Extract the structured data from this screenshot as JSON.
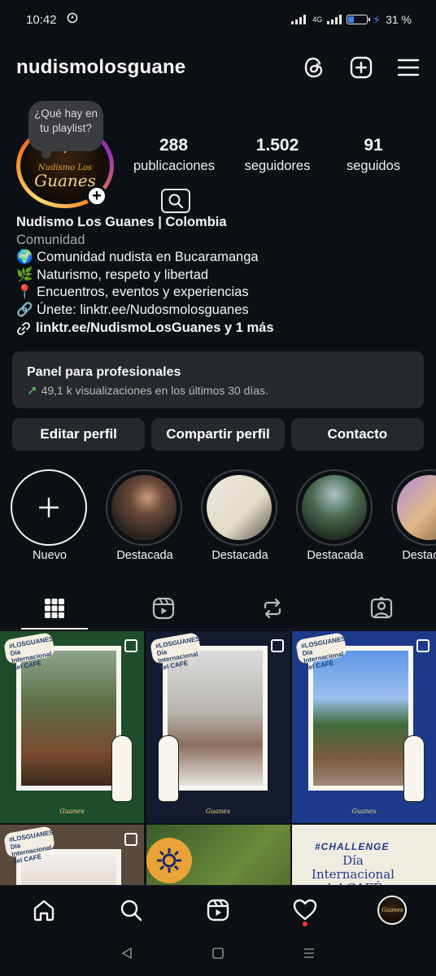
{
  "status_bar": {
    "time": "10:42",
    "battery_pct": "31 %",
    "network": "4G",
    "battery_level": 0.31
  },
  "header": {
    "username": "nudismolosguane",
    "icons": [
      "threads-icon",
      "add-post-icon",
      "menu-icon"
    ]
  },
  "note": {
    "text": "¿Qué hay en tu playlist?"
  },
  "avatar": {
    "logo_top": "Nudismo Los",
    "logo_main": "Guanes"
  },
  "stats": [
    {
      "value": "288",
      "label": "publicaciones"
    },
    {
      "value": "1.502",
      "label": "seguidores"
    },
    {
      "value": "91",
      "label": "seguidos"
    }
  ],
  "bio": {
    "name": "Nudismo Los Guanes | Colombia",
    "category": "Comunidad",
    "lines": [
      "🌍 Comunidad nudista en Bucaramanga",
      "🌿 Naturismo, respeto y libertad",
      "📍 Encuentros, eventos y experiencias",
      "🔗 Únete: linktr.ee/Nudosmolosguanes"
    ],
    "link": "linktr.ee/NudismoLosGuanes y 1 más"
  },
  "pro_panel": {
    "title": "Panel para profesionales",
    "subtitle": "49,1 k visualizaciones en los últimos 30 días."
  },
  "actions": {
    "edit": "Editar perfil",
    "share": "Compartir perfil",
    "contact": "Contacto"
  },
  "highlights": [
    {
      "label": "Nuevo"
    },
    {
      "label": "Destacada"
    },
    {
      "label": "Destacada"
    },
    {
      "label": "Destacada"
    },
    {
      "label": "Destacada"
    }
  ],
  "grid": {
    "tag_text": "#LOSGUANES Día Internacional del CAFÉ",
    "logo_text": "Guanes",
    "challenge_text": "#CHALLENGE",
    "challenge_title": "Día Internacional del CAFÉ"
  },
  "colors": {
    "background": "#0c1014",
    "panel": "#25292e",
    "accent_green": "#5bd56e",
    "notification": "#ff3040"
  }
}
